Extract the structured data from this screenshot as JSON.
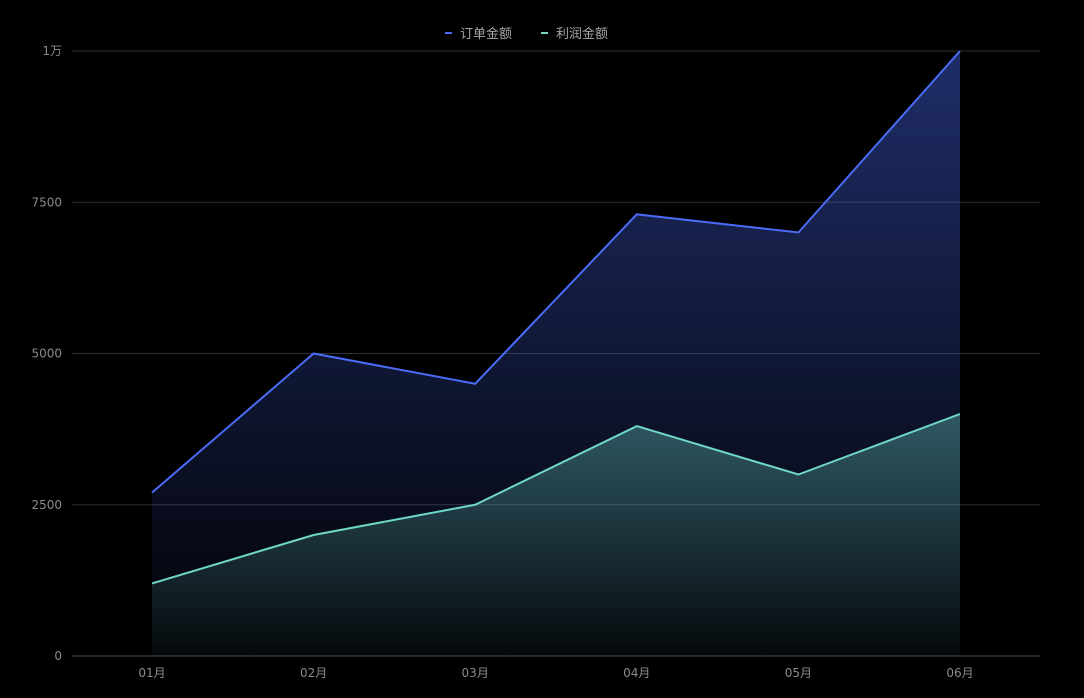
{
  "chart_data": {
    "type": "area",
    "title": "",
    "xlabel": "",
    "ylabel": "",
    "categories": [
      "01月",
      "02月",
      "03月",
      "04月",
      "05月",
      "06月"
    ],
    "ylim": [
      0,
      10000
    ],
    "yticks": [
      0,
      2500,
      5000,
      7500,
      10000
    ],
    "ytick_labels": [
      "0",
      "2500",
      "5000",
      "7500",
      "1万"
    ],
    "grid": true,
    "legend_position": "top-center",
    "series": [
      {
        "name": "订单金额",
        "color": "#4a6cf7",
        "values": [
          2700,
          5000,
          4500,
          7300,
          7000,
          10000
        ]
      },
      {
        "name": "利润金额",
        "color": "#6fd8c6",
        "values": [
          1200,
          2000,
          2500,
          3800,
          3000,
          4000
        ]
      }
    ]
  }
}
